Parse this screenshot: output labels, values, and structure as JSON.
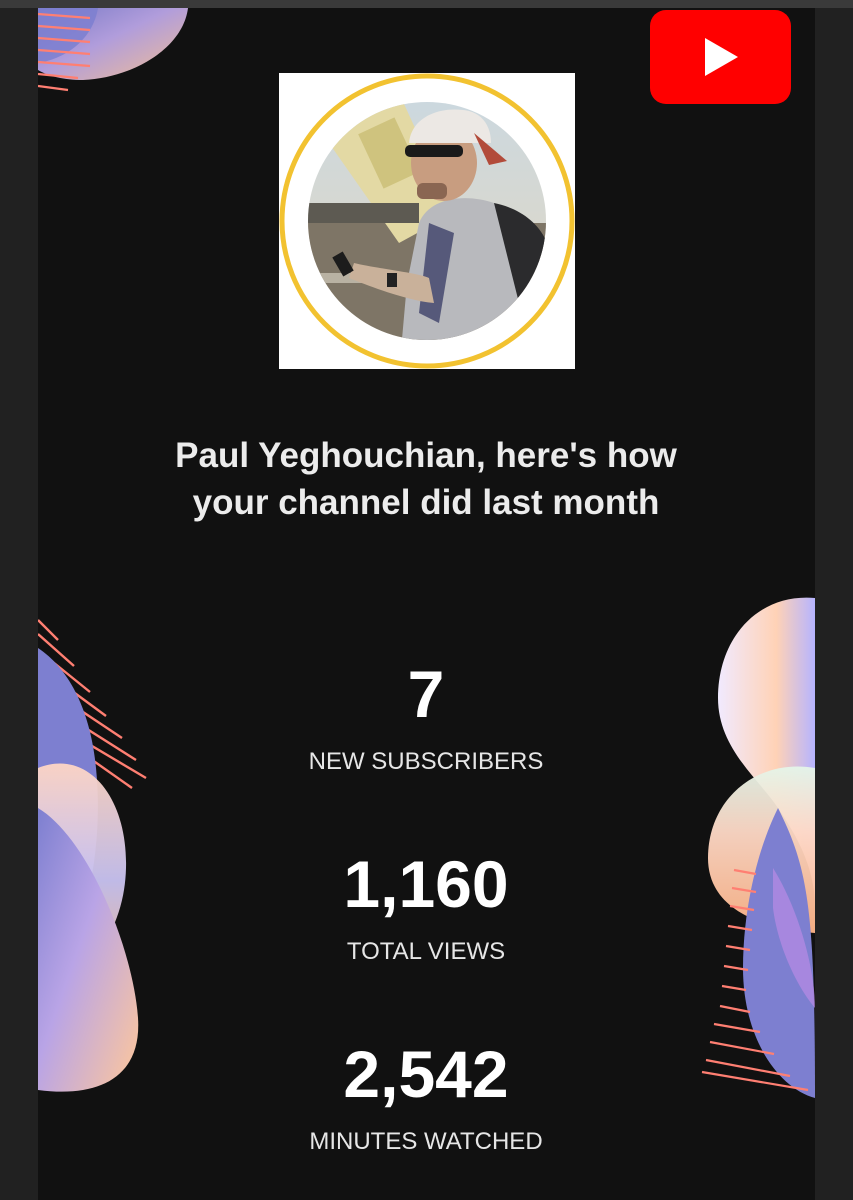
{
  "header": {
    "logo_icon": "youtube-play-icon",
    "brand_color": "#ff0000"
  },
  "profile": {
    "image_alt": "Channel owner profile photo",
    "ring_color": "#f2c230"
  },
  "headline": {
    "line1": "Paul Yeghouchian, here's how",
    "line2": "your channel did last month"
  },
  "stats": [
    {
      "value": "7",
      "label": "NEW SUBSCRIBERS"
    },
    {
      "value": "1,160",
      "label": "TOTAL VIEWS"
    },
    {
      "value": "2,542",
      "label": "MINUTES WATCHED"
    }
  ],
  "colors": {
    "background": "#111111",
    "text": "#ffffff",
    "accent_coral": "#ff8a7a",
    "accent_violet": "#7d7fd0",
    "accent_peach": "#ffc89a"
  }
}
